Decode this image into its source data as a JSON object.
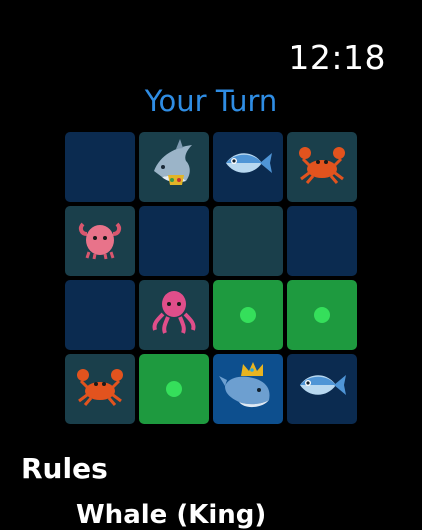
{
  "status_bar": {
    "time": "12:18"
  },
  "header": {
    "title": "Your Turn",
    "title_color": "#2f8de4"
  },
  "board": {
    "rows": 4,
    "cols": 4,
    "cells": [
      [
        {
          "bg": "navy",
          "piece": null
        },
        {
          "bg": "teal",
          "piece": "shark-crowned-icon"
        },
        {
          "bg": "navy",
          "piece": "fish-icon"
        },
        {
          "bg": "teal",
          "piece": "crab-icon"
        }
      ],
      [
        {
          "bg": "teal",
          "piece": "pink-octopus-icon"
        },
        {
          "bg": "navy",
          "piece": null
        },
        {
          "bg": "teal",
          "piece": null
        },
        {
          "bg": "navy",
          "piece": null
        }
      ],
      [
        {
          "bg": "navy",
          "piece": null
        },
        {
          "bg": "teal",
          "piece": "octopus-icon"
        },
        {
          "bg": "green",
          "piece": "move-dot"
        },
        {
          "bg": "green",
          "piece": "move-dot"
        }
      ],
      [
        {
          "bg": "teal",
          "piece": "crab-icon"
        },
        {
          "bg": "green",
          "piece": "move-dot"
        },
        {
          "bg": "blue",
          "piece": "whale-crowned-icon"
        },
        {
          "bg": "navy",
          "piece": "fish-icon"
        }
      ]
    ],
    "colors": {
      "navy": "#0b2b50",
      "teal": "#1a3f4b",
      "green": "#1e9a3f",
      "selected": "#0d4f8e",
      "move_dot": "#35df5b"
    }
  },
  "rules": {
    "title": "Rules",
    "first_item": "Whale (King)"
  }
}
